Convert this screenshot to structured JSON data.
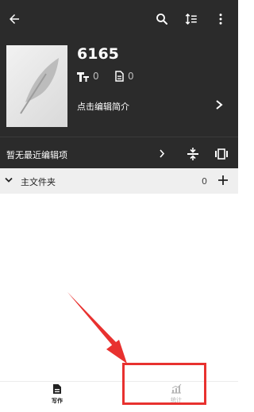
{
  "book": {
    "title": "6165",
    "word_count": "0",
    "chapter_count": "0",
    "intro_label": "点击编辑简介"
  },
  "recent": {
    "label": "暂无最近编辑项"
  },
  "folder": {
    "label": "主文件夹",
    "count": "0"
  },
  "tabs": [
    {
      "label": "写作",
      "icon": "document-icon",
      "active": true
    },
    {
      "label": "统计",
      "icon": "chart-icon",
      "active": false
    }
  ],
  "colors": {
    "header_bg": "#2b2b2b",
    "highlight_red": "#e8312f",
    "annotation_arrow": "#e8312f"
  }
}
